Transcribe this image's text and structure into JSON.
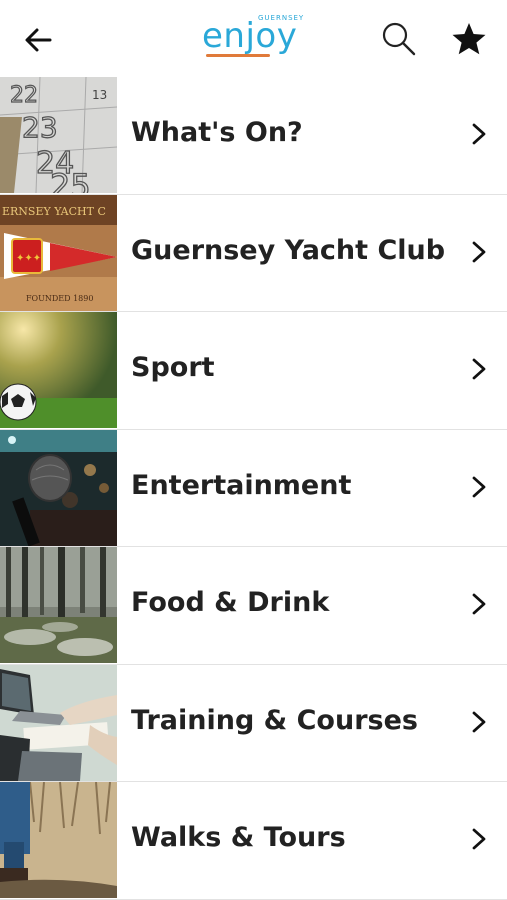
{
  "header": {
    "logo_text": "enjoy",
    "logo_subtext": "GUERNSEY",
    "brand_color": "#2aa8d8",
    "accent_color": "#e07a3a",
    "back_icon": "arrow-left-icon",
    "search_icon": "search-icon",
    "favorites_icon": "star-icon"
  },
  "categories": [
    {
      "label": "What's On?",
      "thumb_icon": "calendar-photo"
    },
    {
      "label": "Guernsey Yacht Club",
      "thumb_icon": "yacht-club-pennant-photo",
      "thumb_text_top": "ERNSEY YACHT C",
      "thumb_text_bottom": "FOUNDED 1890"
    },
    {
      "label": "Sport",
      "thumb_icon": "football-photo"
    },
    {
      "label": "Entertainment",
      "thumb_icon": "microphone-photo"
    },
    {
      "label": "Food & Drink",
      "thumb_icon": "forest-photo"
    },
    {
      "label": "Training & Courses",
      "thumb_icon": "laptop-photo"
    },
    {
      "label": "Walks & Tours",
      "thumb_icon": "walking-photo"
    }
  ]
}
